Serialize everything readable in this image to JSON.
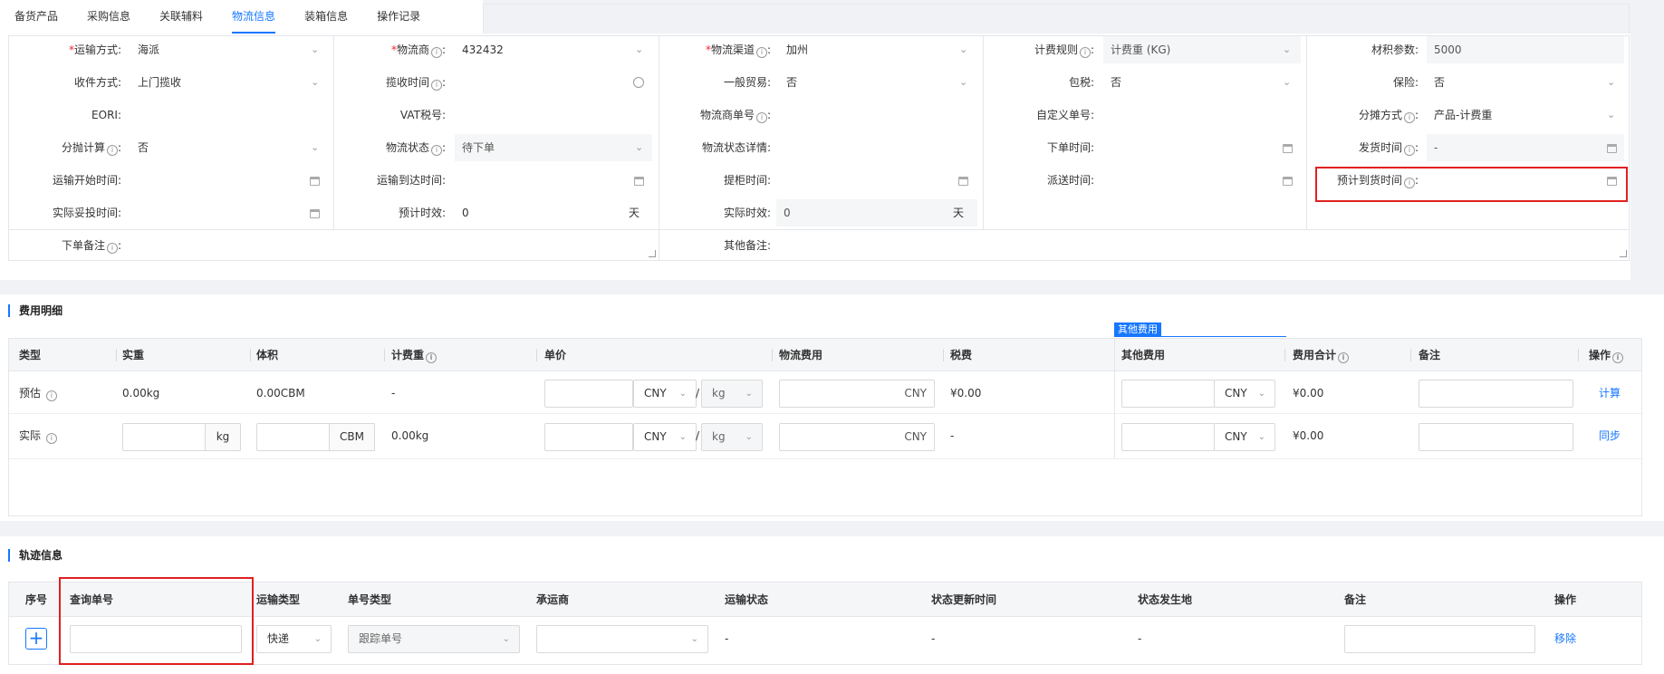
{
  "tabs": [
    "备货产品",
    "采购信息",
    "关联辅料",
    "物流信息",
    "装箱信息",
    "操作记录"
  ],
  "active_tab": "物流信息",
  "form": {
    "col1": {
      "transport_method_label": "运输方式:",
      "transport_method_value": "海派",
      "pickup_method_label": "收件方式:",
      "pickup_method_value": "上门揽收",
      "eori_label": "EORI:",
      "eori_value": "",
      "split_calc_label": "分抛计算",
      "split_calc_value": "否",
      "transport_start_label": "运输开始时间:",
      "actual_delivery_label": "实际妥投时间:"
    },
    "col2": {
      "carrier_label": "物流商",
      "carrier_value": "432432",
      "pickup_time_label": "揽收时间",
      "vat_label": "VAT税号:",
      "status_label": "物流状态",
      "status_value": "待下单",
      "arrival_time_label": "运输到达时间:",
      "est_time_label": "预计时效:",
      "est_time_value": "0",
      "est_time_unit": "天"
    },
    "col3": {
      "channel_label": "物流渠道",
      "channel_value": "加州",
      "general_trade_label": "一般贸易:",
      "general_trade_value": "否",
      "carrier_no_label": "物流商单号",
      "status_detail_label": "物流状态详情:",
      "container_time_label": "提柜时间:",
      "actual_time_label": "实际时效:",
      "actual_time_value": "0",
      "actual_time_unit": "天"
    },
    "col4": {
      "billing_rule_label": "计费规则",
      "billing_rule_value": "计费重 (KG)",
      "tax_incl_label": "包税:",
      "tax_incl_value": "否",
      "custom_no_label": "自定义单号:",
      "order_time_label": "下单时间:",
      "dispatch_time_label": "派送时间:"
    },
    "col5": {
      "vol_param_label": "材积参数:",
      "vol_param_value": "5000",
      "insurance_label": "保险:",
      "insurance_value": "否",
      "allocation_label": "分摊方式",
      "allocation_value": "产品-计费重",
      "ship_time_label": "发货时间",
      "ship_time_value": "-",
      "est_arrival_label": "预计到货时间"
    },
    "order_remark_label": "下单备注",
    "other_remark_label": "其他备注:"
  },
  "fee": {
    "title": "费用明细",
    "other_fee_tag": "其他费用",
    "headers": [
      "类型",
      "实重",
      "体积",
      "计费重",
      "单价",
      "物流费用",
      "税费",
      "其他费用",
      "费用合计",
      "备注",
      "操作"
    ],
    "rows": [
      {
        "type": "预估",
        "weight": "0.00kg",
        "volume": "0.00CBM",
        "charge_weight": "-",
        "price_currency": "CNY",
        "price_unit": "kg",
        "logistics_currency": "CNY",
        "tax": "¥0.00",
        "other_currency": "CNY",
        "total": "¥0.00",
        "action": "计算"
      },
      {
        "type": "实际",
        "weight_unit": "kg",
        "volume_unit": "CBM",
        "charge_weight": "0.00kg",
        "price_currency": "CNY",
        "price_unit": "kg",
        "logistics_currency": "CNY",
        "tax": "-",
        "other_currency": "CNY",
        "total": "¥0.00",
        "action": "同步"
      }
    ]
  },
  "track": {
    "title": "轨迹信息",
    "headers": [
      "序号",
      "查询单号",
      "运输类型",
      "单号类型",
      "承运商",
      "运输状态",
      "状态更新时间",
      "状态发生地",
      "备注",
      "操作"
    ],
    "row": {
      "transport_type": "快递",
      "no_type": "跟踪单号",
      "status": "-",
      "update_time": "-",
      "location": "-",
      "action": "移除"
    }
  },
  "colors": {
    "accent": "#1677ff",
    "highlight": "#e02020",
    "required": "#f5222d"
  },
  "icons": [
    "chevron-down-icon",
    "calendar-icon",
    "clock-icon",
    "info-icon",
    "plus-icon",
    "resize-icon"
  ]
}
